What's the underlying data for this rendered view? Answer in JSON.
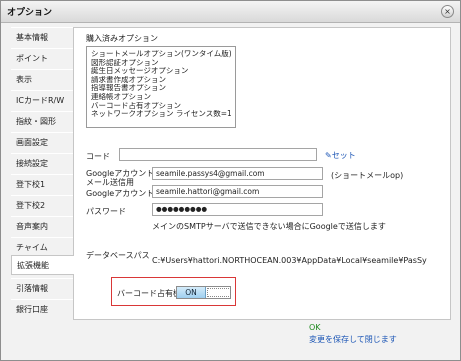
{
  "window": {
    "title": "オプション",
    "close_label": "×"
  },
  "sidebar": {
    "items": [
      {
        "label": "基本情報"
      },
      {
        "label": "ポイント"
      },
      {
        "label": "表示"
      },
      {
        "label": "ICカードR/W"
      },
      {
        "label": "指紋・図形"
      },
      {
        "label": "画面設定"
      },
      {
        "label": "接続設定"
      },
      {
        "label": "登下校1"
      },
      {
        "label": "登下校2"
      },
      {
        "label": "音声案内"
      },
      {
        "label": "チャイム"
      },
      {
        "label": "拡張機能",
        "active": true
      },
      {
        "label": "引落情報"
      },
      {
        "label": "銀行口座"
      }
    ]
  },
  "main": {
    "purchased_label": "購入済みオプション",
    "purchased_options": [
      "ショートメールオプション(ワンタイム版)",
      "図形認証オプション",
      "誕生日メッセージオプション",
      "請求書作成オプション",
      "指導報告書オプション",
      "連絡帳オプション",
      "バーコード占有オプション",
      "ネットワークオプション ライセンス数=1"
    ],
    "code_label": "コード",
    "code_value": "",
    "set_label": "セット",
    "google_mail_label_line1": "Googleアカウント",
    "google_mail_label_line2": "メール送信用",
    "google_mail_value": "seamile.passys4@gmail.com",
    "google_mail_note": "(ショートメールop)",
    "google_account_label": "Googleアカウント",
    "google_account_value": "seamile.hattori@gmail.com",
    "password_label": "パスワード",
    "password_value": "●●●●●●●●●",
    "smtp_note": "メインのSMTPサーバで送信できない場合にGoogleで送信します",
    "db_path_label": "データベースパス",
    "db_path_value": "C:¥Users¥hattori.NORTHOCEAN.003¥AppData¥Local¥seamile¥PasSy",
    "barcode_label": "バーコード占有機能",
    "toggle_on_label": "ON"
  },
  "footer": {
    "ok_label": "OK",
    "ok_sub_label": "変更を保存して閉じます"
  },
  "colors": {
    "highlight": "#d93737",
    "link": "#1b55b5",
    "ok": "#1f8a1f"
  }
}
